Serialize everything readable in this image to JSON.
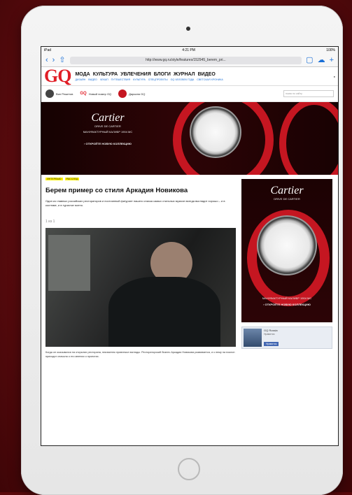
{
  "status": {
    "carrier": "iPad",
    "time": "4:21 PM",
    "battery": "100%"
  },
  "safari": {
    "url": "http://www.gq.ru/style/features/152945_berem_pri..."
  },
  "gq": {
    "logo": "GQ",
    "nav": [
      "МОДА",
      "КУЛЬТУРА",
      "УВЛЕЧЕНИЯ",
      "БЛОГИ",
      "ЖУРНАЛ",
      "ВИДЕО"
    ],
    "subnav": [
      "ДИЗАЙН",
      "ВИДЕО",
      "ЧЕКАП",
      "ПУТЕШЕСТВИЯ",
      "КУЛЬТУРА",
      "СПЕЦПРОЕКТЫ",
      "GQ ЧЕЛОВЕК ГОДА",
      "СВЕТСКАЯ ХРОНИКА"
    ]
  },
  "promo": {
    "items": [
      "Вин Решетов",
      "Новый номер GQ",
      "Дарьиня GQ"
    ],
    "search_placeholder": "поиск по сайту"
  },
  "banner": {
    "brand": "Cartier",
    "line": "DRIVE DE CARTIER",
    "tagline": "МАНУФАКТУРНЫЙ КАЛИБР 1904 MC",
    "cta": "› ОТКРОЙТЕ НОВУЮ КОЛЛЕКЦИЮ"
  },
  "article": {
    "crumbs": [
      "ИНТЕРВЬЮ",
      "РАССЛЕД"
    ],
    "title": "Берем пример со стиля Аркадия Новикова",
    "lead": "Один из главных российских рестораторов и постоянный фигурант нашего списка самых стильных мужчин всегда выглядит хорошо – и в костюме, и в туристке мотно.",
    "pager": "1 из 1",
    "body": "Когда он оказывался на открытии ресторана, неизменно привлекал взгляды. Рестораторский бизнес Аркадия Новикова развивается, и к нему на поклон приходят сначала о его мнении о проектах."
  },
  "sidebar": {
    "ad_brand": "Cartier",
    "ad_line": "DRIVE DE CARTIER",
    "ad_tagline": "МАНУФАКТУРНЫЙ КАЛИБР 1904 MC",
    "ad_cta": "› ОТКРОЙТЕ НОВУЮ КОЛЛЕКЦИЮ",
    "fb_title": "GQ Russia",
    "fb_sub": "Нравится",
    "fb_btn": "Нравится"
  },
  "colors": {
    "brand": "#e01d25",
    "link": "#1a6fd6",
    "ad_red": "#c51621"
  }
}
